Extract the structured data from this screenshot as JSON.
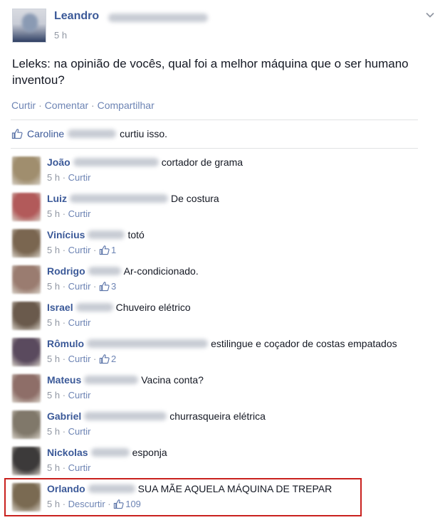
{
  "post": {
    "author": "Leandro",
    "time": "5 h",
    "text": "Leleks: na opinião de vocês, qual foi a melhor máquina que o ser humano inventou?",
    "actions": [
      "Curtir",
      "Comentar",
      "Compartilhar"
    ],
    "likes": {
      "liker": "Caroline",
      "suffix": "curtiu isso."
    },
    "icons": {
      "chevron": "chevron-down-icon",
      "like": "thumbs-up-icon"
    },
    "colors": {
      "name": "#3b5998",
      "link": "#6d84b4",
      "meta": "#9197a3",
      "highlight": "#c9211e"
    }
  },
  "comments": [
    {
      "name": "João",
      "blur_width": 120,
      "text": "cortador de grama",
      "time": "5 h",
      "action": "Curtir",
      "likes": "",
      "avatar": "#a08e6e"
    },
    {
      "name": "Luiz",
      "blur_width": 138,
      "text": "De costura",
      "time": "5 h",
      "action": "Curtir",
      "likes": "",
      "avatar": "#b25a5a"
    },
    {
      "name": "Vinícius",
      "blur_width": 52,
      "text": "totó",
      "time": "5 h",
      "action": "Curtir",
      "likes": "1",
      "avatar": "#7a6650"
    },
    {
      "name": "Rodrigo",
      "blur_width": 46,
      "text": "Ar-condicionado.",
      "time": "5 h",
      "action": "Curtir",
      "likes": "3",
      "avatar": "#9a7c70"
    },
    {
      "name": "Israel",
      "blur_width": 52,
      "text": "Chuveiro elétrico",
      "time": "5 h",
      "action": "Curtir",
      "likes": "",
      "avatar": "#6a5a4c"
    },
    {
      "name": "Rômulo",
      "blur_width": 170,
      "text": "estilingue e coçador de costas empatados",
      "time": "5 h",
      "action": "Curtir",
      "likes": "2",
      "avatar": "#5a4a5e"
    },
    {
      "name": "Mateus",
      "blur_width": 76,
      "text": "Vacina conta?",
      "time": "5 h",
      "action": "Curtir",
      "likes": "",
      "avatar": "#8e6e68"
    },
    {
      "name": "Gabriel",
      "blur_width": 116,
      "text": "churrasqueira elétrica",
      "time": "5 h",
      "action": "Curtir",
      "likes": "",
      "avatar": "#80786a"
    },
    {
      "name": "Nickolas",
      "blur_width": 54,
      "text": "esponja",
      "time": "5 h",
      "action": "Curtir",
      "likes": "",
      "avatar": "#3c3a3a"
    },
    {
      "name": "Orlando",
      "blur_width": 66,
      "text": "SUA MÃE AQUELA MÁQUINA DE TREPAR",
      "time": "5 h",
      "action": "Descurtir",
      "likes": "109",
      "avatar": "#7a6a52"
    }
  ]
}
